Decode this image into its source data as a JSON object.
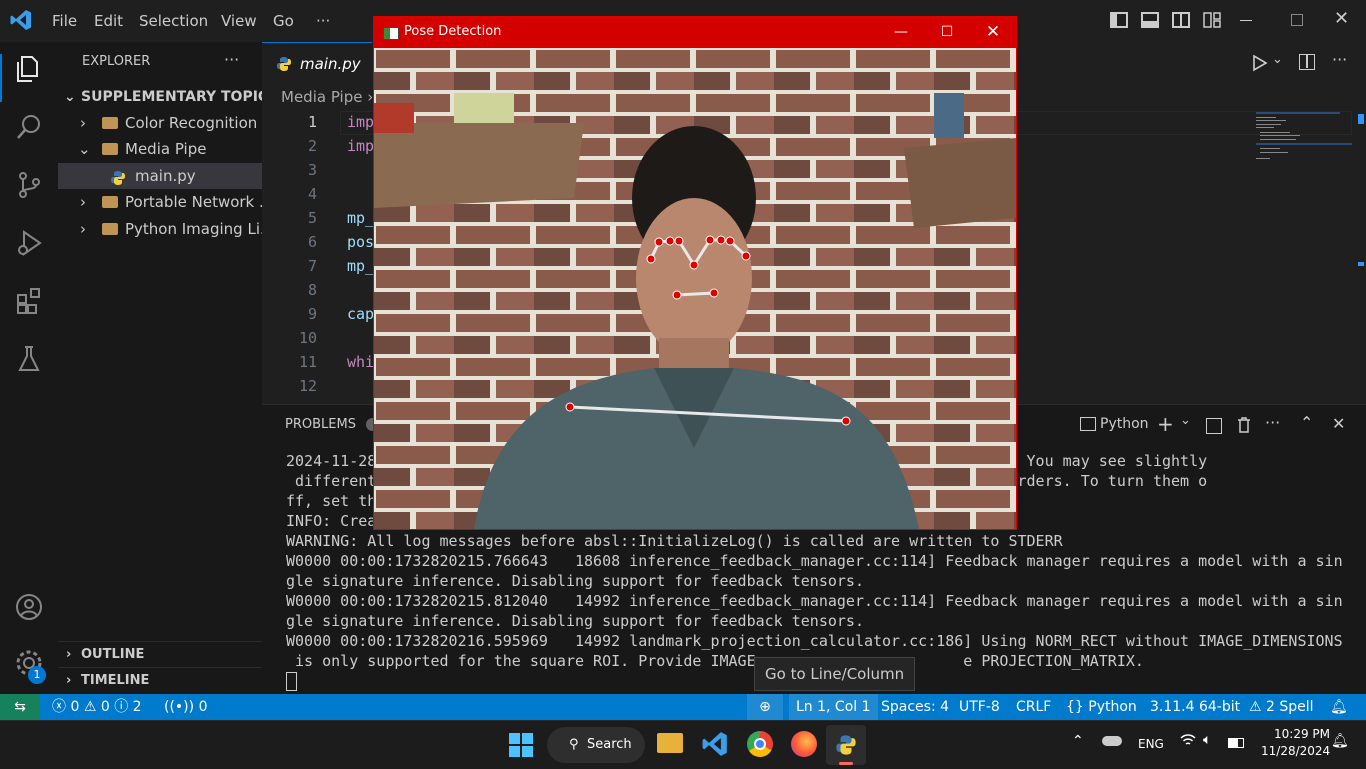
{
  "titlebar": {
    "menu": [
      "File",
      "Edit",
      "Selection",
      "View",
      "Go",
      "···"
    ]
  },
  "sidebar": {
    "header": "EXPLORER",
    "section": "SUPPLEMENTARY TOPICS",
    "items": [
      {
        "label": "Color Recognition"
      },
      {
        "label": "Media Pipe"
      },
      {
        "label": "main.py"
      },
      {
        "label": "Portable Network ..."
      },
      {
        "label": "Python Imaging Li..."
      }
    ],
    "outline": "OUTLINE",
    "timeline": "TIMELINE",
    "accounts_badge": "1"
  },
  "editor": {
    "tab": "main.py",
    "breadcrumb": "Media Pipe",
    "line_numbers": [
      "1",
      "2",
      "3",
      "4",
      "5",
      "6",
      "7",
      "8",
      "9",
      "10",
      "11",
      "12"
    ],
    "code": [
      "imp",
      "imp",
      "",
      "",
      "mp_",
      "pos",
      "mp_",
      "",
      "cap",
      "",
      "whi",
      ""
    ]
  },
  "panel": {
    "tab_problems": "PROBLEMS",
    "problems_count": "2",
    "terminal_name": "Python",
    "lines": [
      "2024-11-28                                                        rations are on. You may see slightly",
      " different                                                        t computation orders. To turn them o",
      "ff, set th",
      "INFO: Crea",
      "WARNING: All log messages before absl::InitializeLog() is called are written to STDERR",
      "W0000 00:00:1732820215.766643   18608 inference_feedback_manager.cc:114] Feedback manager requires a model with a sin",
      "gle signature inference. Disabling support for feedback tensors.",
      "W0000 00:00:1732820215.812040   14992 inference_feedback_manager.cc:114] Feedback manager requires a model with a sin",
      "gle signature inference. Disabling support for feedback tensors.",
      "W0000 00:00:1732820216.595969   14992 landmark_projection_calculator.cc:186] Using NORM_RECT without IMAGE_DIMENSIONS",
      " is only supported for the square ROI. Provide IMAGE                       e PROJECTION_MATRIX."
    ]
  },
  "tooltip": "Go to Line/Column",
  "statusbar": {
    "errors": "0",
    "warnings": "0",
    "infos": "2",
    "ports": "0",
    "position": "Ln 1, Col 1",
    "spaces": "Spaces: 4",
    "encoding": "UTF-8",
    "eol": "CRLF",
    "language": "Python",
    "interpreter": "3.11.4 64-bit",
    "spell": "2 Spell"
  },
  "taskbar": {
    "search": "Search",
    "lang": "ENG",
    "time": "10:29 PM",
    "date": "11/28/2024"
  },
  "pose_window": {
    "title": "Pose Detection"
  }
}
